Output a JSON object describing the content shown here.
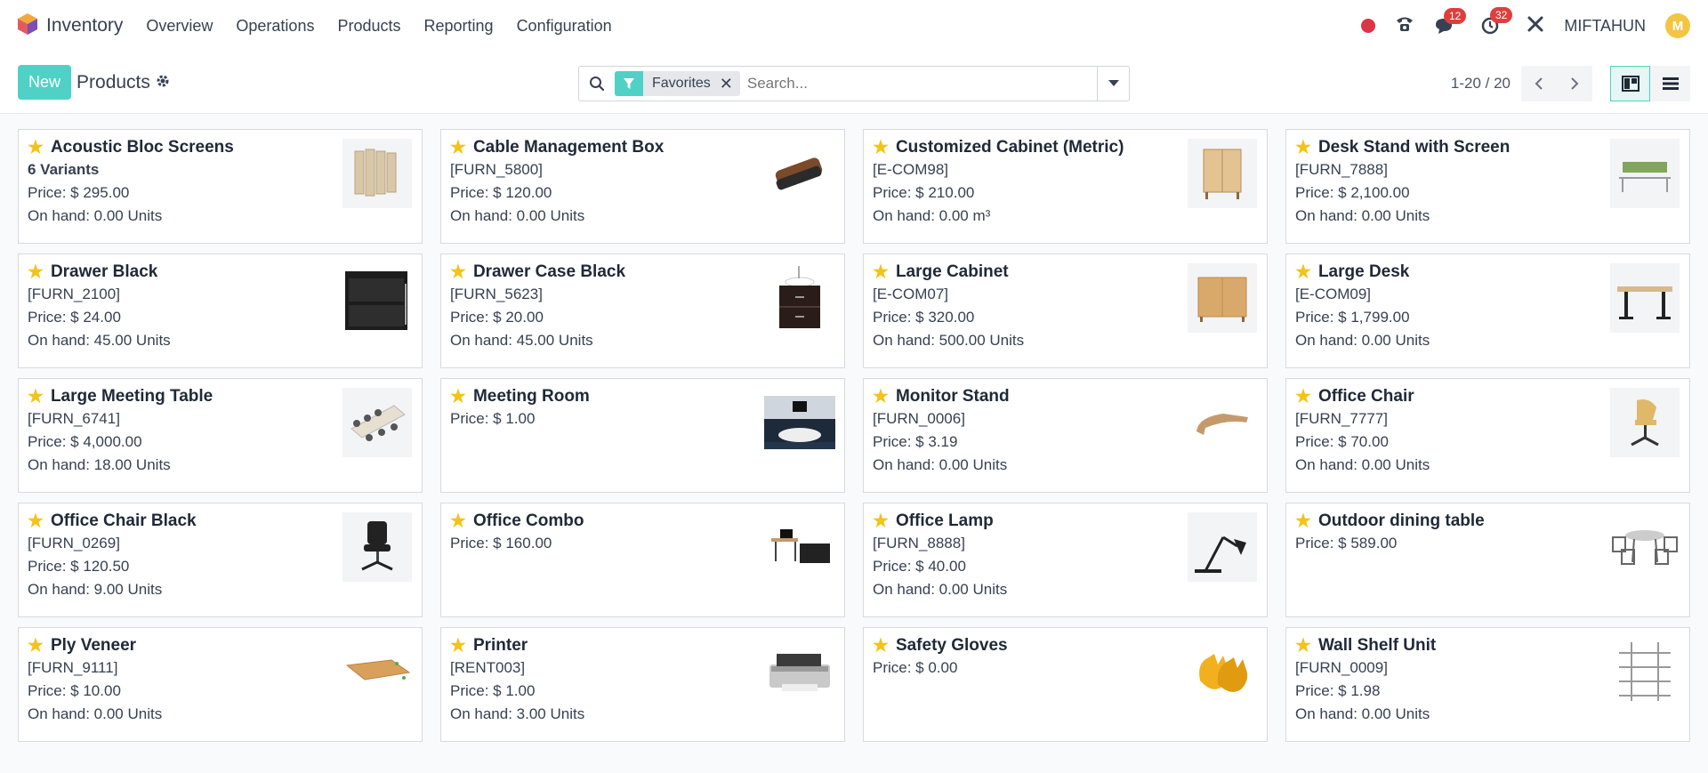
{
  "app": {
    "name": "Inventory"
  },
  "menu": [
    "Overview",
    "Operations",
    "Products",
    "Reporting",
    "Configuration"
  ],
  "systray": {
    "messages_count": "12",
    "activities_count": "32",
    "user_name": "MIFTAHUN",
    "avatar_letter": "M"
  },
  "control": {
    "new_label": "New",
    "title": "Products",
    "facet_label": "Favorites",
    "search_placeholder": "Search...",
    "pager": "1-20 / 20"
  },
  "colors": {
    "accent": "#4fd1c5",
    "star": "#f3c316",
    "badge": "#e03e3e"
  },
  "products": [
    {
      "name": "Acoustic Bloc Screens",
      "variants": "6 Variants",
      "price": "Price: $ 295.00",
      "onhand": "On hand: 0.00 Units",
      "thumb": "screen"
    },
    {
      "name": "Cable Management Box",
      "code": "[FURN_5800]",
      "price": "Price: $ 120.00",
      "onhand": "On hand: 0.00 Units",
      "thumb": "cablebox"
    },
    {
      "name": "Customized Cabinet (Metric)",
      "code": "[E-COM98]",
      "price": "Price: $ 210.00",
      "onhand": "On hand: 0.00 m³",
      "thumb": "cabinet"
    },
    {
      "name": "Desk Stand with Screen",
      "code": "[FURN_7888]",
      "price": "Price: $ 2,100.00",
      "onhand": "On hand: 0.00 Units",
      "thumb": "deskscreen"
    },
    {
      "name": "Drawer Black",
      "code": "[FURN_2100]",
      "price": "Price: $ 24.00",
      "onhand": "On hand: 45.00 Units",
      "thumb": "drawerblack"
    },
    {
      "name": "Drawer Case Black",
      "code": "[FURN_5623]",
      "price": "Price: $ 20.00",
      "onhand": "On hand: 45.00 Units",
      "thumb": "drawercase"
    },
    {
      "name": "Large Cabinet",
      "code": "[E-COM07]",
      "price": "Price: $ 320.00",
      "onhand": "On hand: 500.00 Units",
      "thumb": "largecabinet"
    },
    {
      "name": "Large Desk",
      "code": "[E-COM09]",
      "price": "Price: $ 1,799.00",
      "onhand": "On hand: 0.00 Units",
      "thumb": "desk"
    },
    {
      "name": "Large Meeting Table",
      "code": "[FURN_6741]",
      "price": "Price: $ 4,000.00",
      "onhand": "On hand: 18.00 Units",
      "thumb": "meetingtable"
    },
    {
      "name": "Meeting Room",
      "price": "Price: $ 1.00",
      "thumb": "room"
    },
    {
      "name": "Monitor Stand",
      "code": "[FURN_0006]",
      "price": "Price: $ 3.19",
      "onhand": "On hand: 0.00 Units",
      "thumb": "monitorstand"
    },
    {
      "name": "Office Chair",
      "code": "[FURN_7777]",
      "price": "Price: $ 70.00",
      "onhand": "On hand: 0.00 Units",
      "thumb": "chair"
    },
    {
      "name": "Office Chair Black",
      "code": "[FURN_0269]",
      "price": "Price: $ 120.50",
      "onhand": "On hand: 9.00 Units",
      "thumb": "chairblack"
    },
    {
      "name": "Office Combo",
      "price": "Price: $ 160.00",
      "thumb": "combo"
    },
    {
      "name": "Office Lamp",
      "code": "[FURN_8888]",
      "price": "Price: $ 40.00",
      "onhand": "On hand: 0.00 Units",
      "thumb": "lamp"
    },
    {
      "name": "Outdoor dining table",
      "price": "Price: $ 589.00",
      "thumb": "dining"
    },
    {
      "name": "Ply Veneer",
      "code": "[FURN_9111]",
      "price": "Price: $ 10.00",
      "onhand": "On hand: 0.00 Units",
      "thumb": "veneer"
    },
    {
      "name": "Printer",
      "code": "[RENT003]",
      "price": "Price: $ 1.00",
      "onhand": "On hand: 3.00 Units",
      "thumb": "printer"
    },
    {
      "name": "Safety Gloves",
      "price": "Price: $ 0.00",
      "thumb": "gloves"
    },
    {
      "name": "Wall Shelf Unit",
      "code": "[FURN_0009]",
      "price": "Price: $ 1.98",
      "onhand": "On hand: 0.00 Units",
      "thumb": "shelf"
    }
  ]
}
